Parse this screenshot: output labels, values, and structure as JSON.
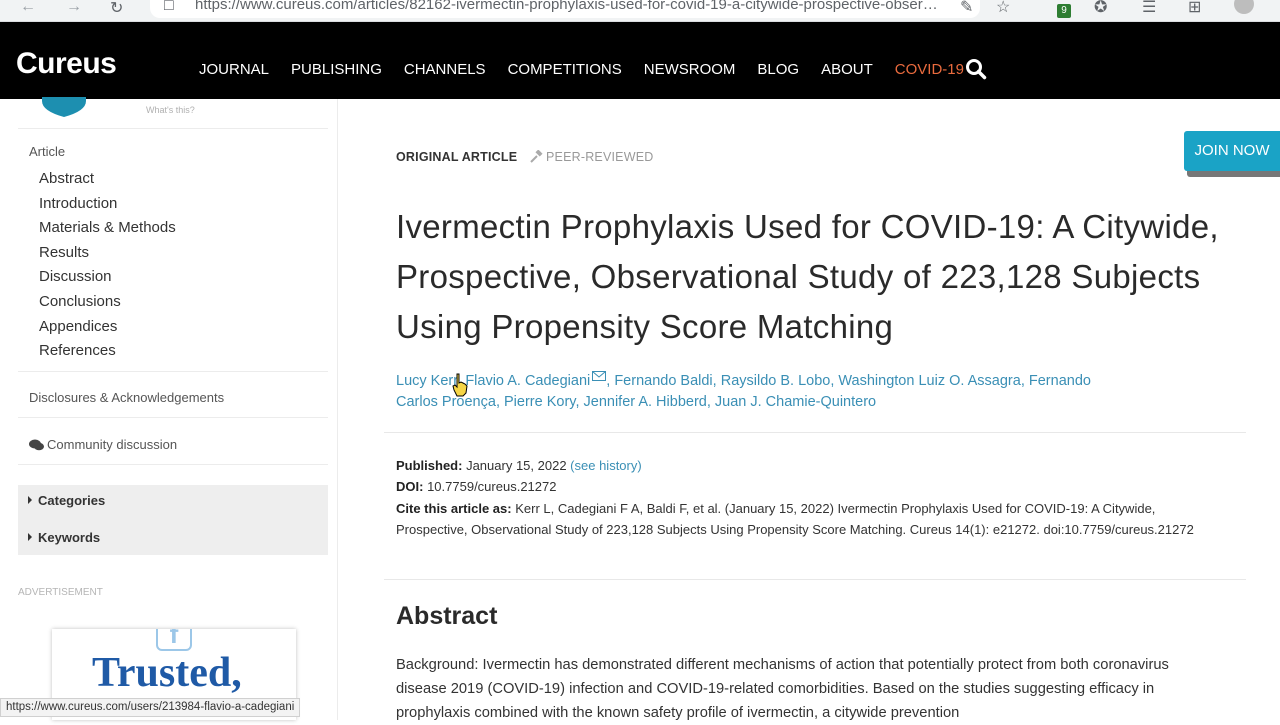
{
  "browser": {
    "url": "https://www.cureus.com/articles/82162-ivermectin-prophylaxis-used-for-covid-19-a-citywide-prospective-observati...",
    "extension_badge": "9",
    "status_url": "https://www.cureus.com/users/213984-flavio-a-cadegiani"
  },
  "header": {
    "logo": "Cureus",
    "nav": [
      "JOURNAL",
      "PUBLISHING",
      "CHANNELS",
      "COMPETITIONS",
      "NEWSROOM",
      "BLOG",
      "ABOUT",
      "COVID-19"
    ],
    "accent_color": "#ea6b3e"
  },
  "sidebar": {
    "whats_this": "What's this?",
    "section_label": "Article",
    "items": [
      "Abstract",
      "Introduction",
      "Materials & Methods",
      "Results",
      "Discussion",
      "Conclusions",
      "Appendices",
      "References"
    ],
    "disclosures": "Disclosures & Acknowledgements",
    "community": "Community discussion",
    "categories": "Categories",
    "keywords": "Keywords",
    "ad_label": "ADVERTISEMENT",
    "ad_text": "Trusted,"
  },
  "article": {
    "type_label": "ORIGINAL ARTICLE",
    "peer_label": "PEER-REVIEWED",
    "join_now": "JOIN NOW",
    "title": "Ivermectin Prophylaxis Used for COVID-19: A Citywide, Prospective, Observational Study of 223,128 Subjects Using Propensity Score Matching",
    "authors": [
      "Lucy Kerr",
      "Flavio A. Cadegiani",
      "Fernando Baldi",
      "Raysildo B. Lobo",
      "Washington Luiz O. Assagra",
      "Fernando Carlos Proença",
      "Pierre Kory",
      "Jennifer A. Hibberd",
      "Juan J. Chamie-Quintero"
    ],
    "published_label": "Published:",
    "published_date": "January 15, 2022",
    "see_history": "(see history)",
    "doi_label": "DOI:",
    "doi": "10.7759/cureus.21272",
    "cite_label": "Cite this article as:",
    "cite_text": "Kerr L, Cadegiani F A, Baldi F, et al. (January 15, 2022) Ivermectin Prophylaxis Used for COVID-19: A Citywide, Prospective, Observational Study of 223,128 Subjects Using Propensity Score Matching. Cureus 14(1): e21272. doi:10.7759/cureus.21272",
    "abstract_heading": "Abstract",
    "abstract_text": "Background: Ivermectin has demonstrated different mechanisms of action that potentially protect from both coronavirus disease 2019 (COVID-19) infection and COVID-19-related comorbidities. Based on the studies suggesting efficacy in prophylaxis combined with the known safety profile of ivermectin, a citywide prevention"
  },
  "colors": {
    "link": "#3a8fb5",
    "join_now_bg": "#1aa3c6",
    "header_bg": "#000000"
  }
}
